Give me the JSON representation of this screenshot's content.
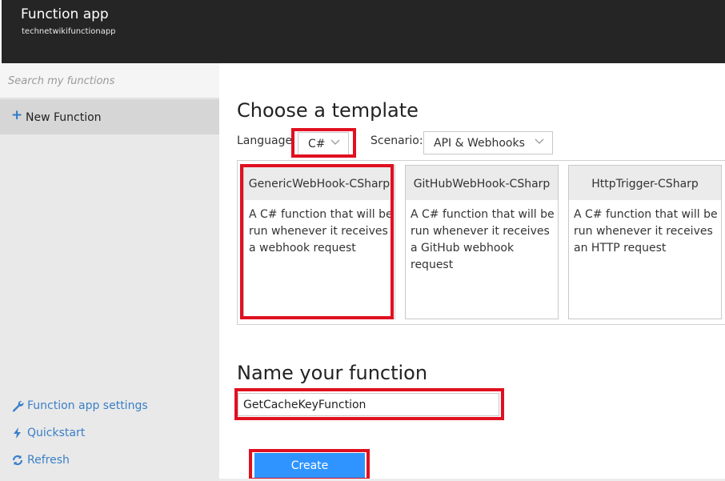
{
  "header": {
    "title": "Function app",
    "subtitle": "technetwikifunctionapp"
  },
  "sidebar": {
    "search_placeholder": "Search my functions",
    "new_function_label": "New Function",
    "links": [
      {
        "label": "Function app settings",
        "icon": "wrench-icon"
      },
      {
        "label": "Quickstart",
        "icon": "lightning-icon"
      },
      {
        "label": "Refresh",
        "icon": "refresh-icon"
      }
    ]
  },
  "main": {
    "choose_template_heading": "Choose a template",
    "language_label": "Language",
    "language_value": "C#",
    "scenario_label": "Scenario:",
    "scenario_value": "API & Webhooks",
    "templates": [
      {
        "name": "GenericWebHook-CSharp",
        "description": "A C# function that will be run whenever it receives a webhook request"
      },
      {
        "name": "GitHubWebHook-CSharp",
        "description": "A C# function that will be run whenever it receives a GitHub webhook request"
      },
      {
        "name": "HttpTrigger-CSharp",
        "description": "A C# function that will be run whenever it receives an HTTP request"
      }
    ],
    "name_heading": "Name your function",
    "function_name_value": "GetCacheKeyFunction",
    "create_label": "Create"
  },
  "colors": {
    "topbar": "#252526",
    "sidebar": "#e9e9e9",
    "accent": "#3079c8",
    "create_button": "#2f94ff",
    "highlight": "#e01020"
  }
}
